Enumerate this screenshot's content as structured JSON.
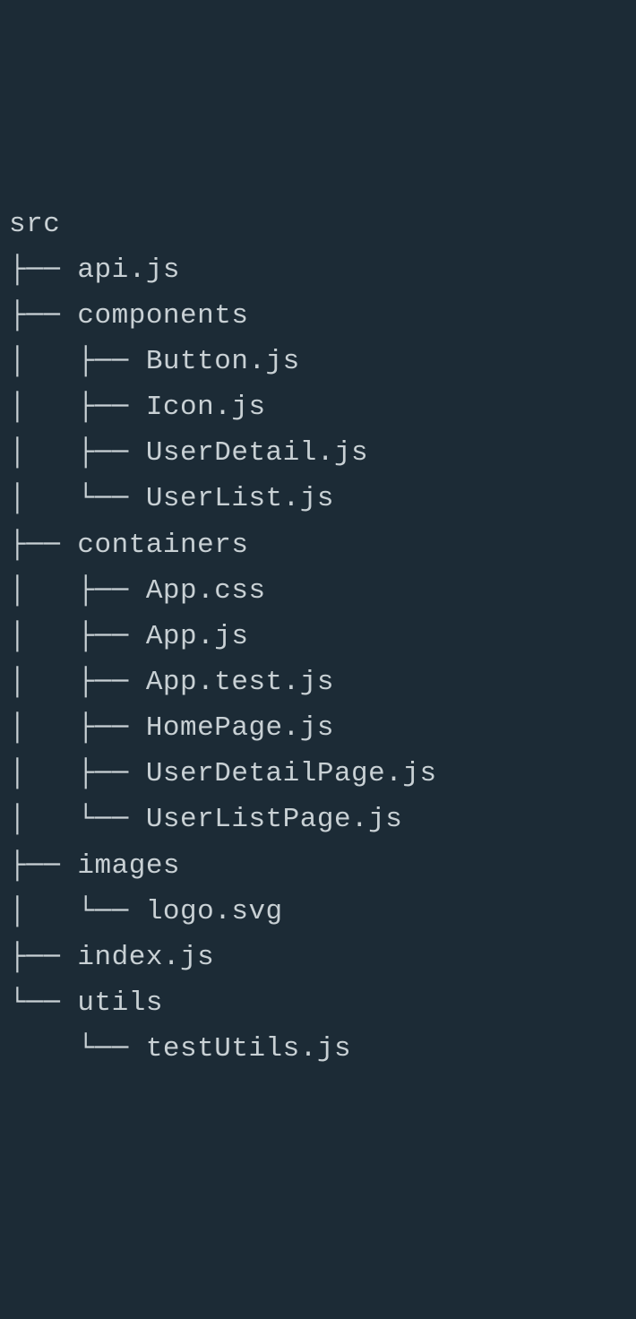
{
  "tree": {
    "root": "src",
    "lines": [
      "src",
      "├── api.js",
      "├── components",
      "│   ├── Button.js",
      "│   ├── Icon.js",
      "│   ├── UserDetail.js",
      "│   └── UserList.js",
      "├── containers",
      "│   ├── App.css",
      "│   ├── App.js",
      "│   ├── App.test.js",
      "│   ├── HomePage.js",
      "│   ├── UserDetailPage.js",
      "│   └── UserListPage.js",
      "├── images",
      "│   └── logo.svg",
      "├── index.js",
      "└── utils",
      "    └── testUtils.js"
    ]
  }
}
